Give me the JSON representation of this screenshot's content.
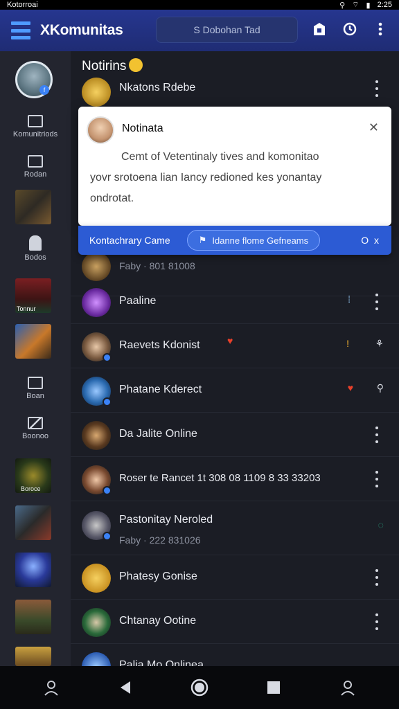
{
  "status_bar": {
    "left": "Kotorroai",
    "right": "2:25"
  },
  "header": {
    "app_title": "XKomunitas",
    "search_text": "S Dobohan Tad"
  },
  "sidebar": {
    "items": [
      {
        "label": "Komunitriods"
      },
      {
        "label": "Rodan"
      },
      {
        "label": "Bodos"
      },
      {
        "label": "Tonnur"
      },
      {
        "label": "Boan"
      },
      {
        "label": "Boonoo"
      },
      {
        "label": "Boroce"
      }
    ]
  },
  "notifications": {
    "title": "Notirins",
    "top_row": {
      "name": "Nkatons Rdebe"
    }
  },
  "card": {
    "title": "Notinata",
    "line1": "Cemt of Vetentinaly tives and komonitao",
    "line2": "yovr srotoena lian Iancy redioned kes yonantay",
    "line3": "ondrotat."
  },
  "banner": {
    "label": "Kontachrary Came",
    "pill": "Idanne flome Gefneams",
    "right": "O x"
  },
  "rows": [
    {
      "name": "",
      "sub": "Faby · 801 81008",
      "tag": ""
    },
    {
      "name": "Paaline",
      "sub": "",
      "tag": ""
    },
    {
      "name": "Raevets Kdonist",
      "sub": "",
      "tag": "♥"
    },
    {
      "name": "Phatane Kderect",
      "sub": "",
      "tag": ""
    },
    {
      "name": "Da Jalite Online",
      "sub": "",
      "tag": ""
    },
    {
      "name": "Roser te Rancet 1t 308 08 1109 8 33 33203",
      "sub": "",
      "tag": ""
    },
    {
      "name": "Pastonitay Neroled",
      "sub": "Faby · 222 831026",
      "tag": ""
    },
    {
      "name": "Phatesy Gonise",
      "sub": "",
      "tag": ""
    },
    {
      "name": "Chtanay Ootine",
      "sub": "",
      "tag": ""
    },
    {
      "name": "Palia Mo Onlinea",
      "sub": "",
      "tag": ""
    }
  ],
  "colors": {
    "header_bg": "#26368f",
    "accent": "#4f9bff",
    "banner_bg": "#2c5bd4",
    "sidebar_bg": "#23252f",
    "content_bg": "#1b1d25"
  },
  "icons": {
    "nav": [
      "person-icon",
      "back-icon",
      "home-icon",
      "recents-icon",
      "profile-icon"
    ]
  }
}
